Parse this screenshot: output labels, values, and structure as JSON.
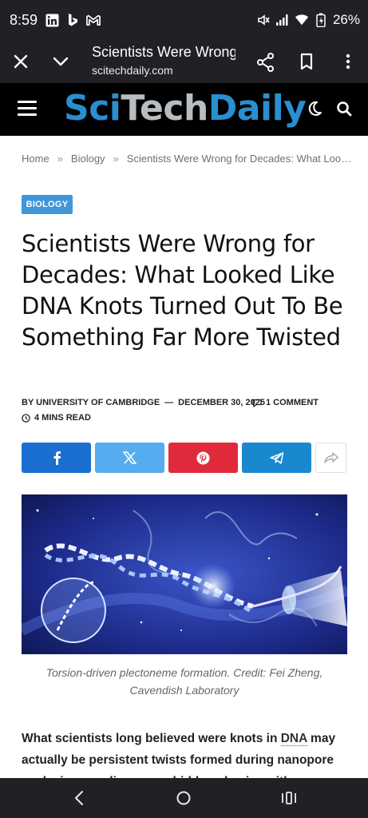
{
  "status_bar": {
    "time": "8:59",
    "battery": "26%",
    "left_icons": [
      "linkedin-icon",
      "bing-icon",
      "gmail-icon"
    ],
    "right_icons": [
      "mute-icon",
      "signal-icon",
      "wifi-icon",
      "battery-icon"
    ]
  },
  "browser": {
    "title": "Scientists Were Wrong for Decades…",
    "url": "scitechdaily.com"
  },
  "site": {
    "logo_sci": "Sci",
    "logo_tech": "Tech",
    "logo_daily": "Daily"
  },
  "breadcrumb": {
    "home": "Home",
    "sep": "»",
    "category": "Biology",
    "current": "Scientists Were Wrong for Decades: What Loo…"
  },
  "article": {
    "category_badge": "BIOLOGY",
    "headline": "Scientists Were Wrong for Decades: What Looked Like DNA Knots Turned Out To Be Something Far More Twisted",
    "byline": "BY UNIVERSITY OF CAMBRIDGE",
    "dash": "—",
    "date": "DECEMBER 30, 2025",
    "comments": "1 COMMENT",
    "read_time": "4 MINS READ",
    "caption_line1": "Torsion-driven plectoneme formation. Credit: Fei Zheng,",
    "caption_line2": "Cavendish Laboratory",
    "body_part1": "What scientists long believed were knots in ",
    "body_link": "DNA",
    "body_part2": " may actually be persistent twists formed during nanopore analysis, revealing a new hidden physics with…"
  },
  "share_buttons": [
    "facebook-icon",
    "x-icon",
    "pinterest-icon",
    "telegram-icon",
    "forward-icon"
  ],
  "colors": {
    "accent": "#2a8fd0",
    "facebook": "#1a6fd1",
    "twitter": "#55acee",
    "pinterest": "#e02a3c",
    "telegram": "#1a88cf"
  }
}
